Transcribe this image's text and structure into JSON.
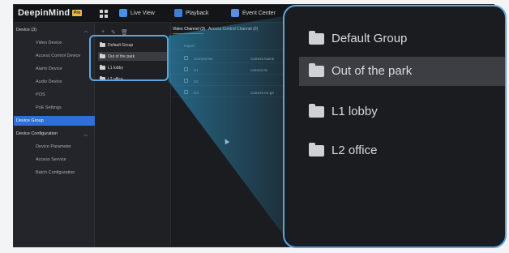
{
  "app": {
    "logo": "DeepinMind",
    "logo_badge": "Pro"
  },
  "topbar": {
    "tabs": [
      {
        "label": "Live View",
        "icon": "live-view-icon",
        "color": "#4a8fe7"
      },
      {
        "label": "Playback",
        "icon": "playback-icon",
        "color": "#3b7fd8"
      },
      {
        "label": "Event Center",
        "icon": "event-center-icon",
        "color": "#5b8de0"
      }
    ]
  },
  "sidebar": {
    "device_header": "Device (3)",
    "device_items": [
      "Video Device",
      "Access Control Device",
      "Alarm Device",
      "Audio Device",
      "POS",
      "PoE Settings"
    ],
    "device_group": "Device Group",
    "config_header": "Device Configuration",
    "config_items": [
      "Device Parameter",
      "Access Service",
      "Batch Configuration"
    ]
  },
  "group_panel": {
    "tools": [
      "add-icon",
      "edit-icon",
      "delete-icon"
    ],
    "groups": [
      "Default Group",
      "Out of the park",
      "L1 lobby",
      "L2 office"
    ],
    "selected_index": 1
  },
  "channel_panel": {
    "tabs": [
      "Video Channel (3)",
      "Access Control Channel (0)"
    ],
    "import_label": "Import",
    "columns": [
      "Camera No.",
      "Camera Name"
    ],
    "rows": [
      {
        "no": "D1",
        "name": "camera 01"
      },
      {
        "no": "D2",
        "name": ""
      },
      {
        "no": "D3",
        "name": "Camera 01-g3"
      }
    ]
  },
  "callout": {
    "groups": [
      "Default Group",
      "Out of the park",
      "L1 lobby",
      "L2 office"
    ],
    "selected_index": 1
  },
  "colors": {
    "accent": "#2e6fd6",
    "highlight_border": "#5aa7df",
    "logo_badge": "#e8b84b"
  }
}
